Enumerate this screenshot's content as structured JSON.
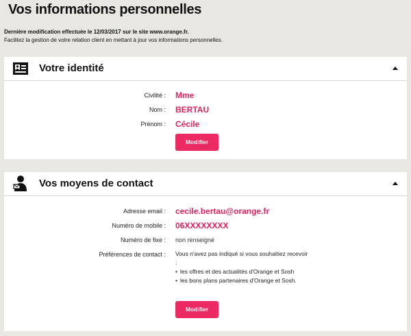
{
  "page": {
    "title": "Vos informations personnelles",
    "last_modified": "Dernière modification effectuée le 12/03/2017 sur le site www.orange.fr.",
    "subtitle": "Facilitez la gestion de votre relation client en mettant à jour vos informations personnelles."
  },
  "identity": {
    "title": "Votre identité",
    "icon": "id-card-icon",
    "fields": [
      {
        "label": "Civilité :",
        "value": "Mme"
      },
      {
        "label": "Nom :",
        "value": "BERTAU"
      },
      {
        "label": "Prénom :",
        "value": "Cécile"
      }
    ],
    "button_label": "Modifier"
  },
  "contact": {
    "title": "Vos moyens de contact",
    "icon": "person-contact-icon",
    "fields": [
      {
        "label": "Adresse email :",
        "value": "cecile.bertau@orange.fr"
      },
      {
        "label": "Numéro de mobile :",
        "value": "06XXXXXXXX"
      },
      {
        "label": "Numéro de fixe :",
        "value": "non renseigné"
      }
    ],
    "preferences": {
      "label": "Préférences de contact :",
      "intro": "Vous n'avez pas indiqué si vous souhaitiez recevoir",
      "colon": ":",
      "items": [
        "les offres et des actualités d'Orange et Sosh",
        "les bons plans partenaires d'Orange et Sosh."
      ]
    },
    "button_label": "Modifier"
  },
  "colors": {
    "accent": "#eb2a63",
    "value_text": "#e0245e",
    "background": "#e8e7e2"
  }
}
